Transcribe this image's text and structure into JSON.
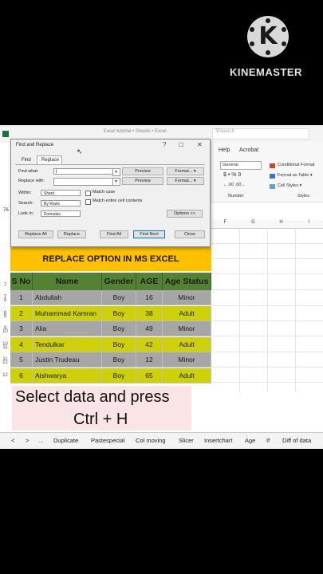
{
  "watermark": {
    "logo_letter": "K",
    "brand": "KINEMASTER"
  },
  "window": {
    "title": "Excel tutorial • Sheets • Excel",
    "search_placeholder": "Search",
    "cell_ref": "76"
  },
  "ribbon": {
    "tabs": [
      "Help",
      "Acrobat"
    ],
    "number_format": "General",
    "number_symbols": "$ • % 9",
    "number_decimals": "←.00  .00→",
    "number_group": "Number",
    "conditional_formatting": "Conditional Format",
    "format_as_table": "Format as Table ▾",
    "cell_styles": "Cell Styles ▾",
    "styles_group": "Styles"
  },
  "dialog": {
    "title": "Find and Replace",
    "tabs": [
      "Find",
      "Replace"
    ],
    "find_label": "Find what:",
    "find_value": "l",
    "replace_label": "Replace with:",
    "replace_value": "",
    "preview": "Preview",
    "format": "Format...",
    "within_label": "Within:",
    "within_value": "Sheet",
    "search_label": "Search:",
    "search_value": "By Rows",
    "lookin_label": "Look in:",
    "lookin_value": "Formulas",
    "match_case": "Match case",
    "match_entire": "Match entire cell contents",
    "options": "Options <<",
    "buttons": [
      "Replace All",
      "Replace",
      "Find All",
      "Find Next",
      "Close"
    ]
  },
  "grid": {
    "columns": [
      "F",
      "G",
      "H",
      "I"
    ],
    "rows": [
      "1",
      "2",
      "3",
      "4",
      "5",
      "6",
      "7",
      "8",
      "9",
      "10",
      "11",
      "12"
    ]
  },
  "table": {
    "banner": "REPLACE OPTION IN MS EXCEL",
    "headers": [
      "S No",
      "Name",
      "Gender",
      "AGE",
      "Age Status"
    ],
    "rows": [
      [
        "1",
        "Abdullah",
        "Boy",
        "16",
        "Minor"
      ],
      [
        "2",
        "Muhammad  Kamran",
        "Boy",
        "38",
        "Adult"
      ],
      [
        "3",
        "Alia",
        "Boy",
        "49",
        "Minor"
      ],
      [
        "4",
        "Tendulkar",
        "Boy",
        "42",
        "Adult"
      ],
      [
        "5",
        "Justin Trudeau",
        "Boy",
        "12",
        "Minor"
      ],
      [
        "6",
        "Aishwarya",
        "Boy",
        "65",
        "Adult"
      ]
    ],
    "colors": {
      "header": "#548235",
      "odd_row": "#a6a6a6",
      "even_row": "#ced10a",
      "banner": "#ffc000"
    }
  },
  "caption": {
    "line1": "Select data and press",
    "line2": "Ctrl + H"
  },
  "sheet_tabs": [
    "<",
    ">",
    "...",
    "Duplicate",
    "Pastespecial",
    "Col moving",
    "Slicer",
    "Insertchart",
    "Age",
    "If",
    "Diff of data"
  ]
}
